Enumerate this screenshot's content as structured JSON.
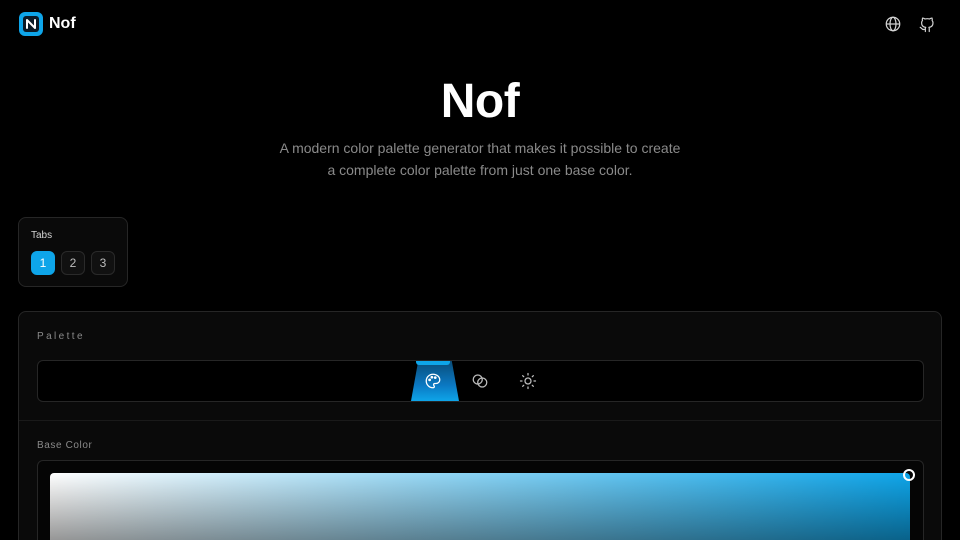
{
  "header": {
    "logo_letter": "N",
    "brand": "Nof",
    "icons": [
      "globe-icon",
      "github-icon"
    ]
  },
  "hero": {
    "title": "Nof",
    "subtitle_line1": "A modern color palette generator that makes it possible to create",
    "subtitle_line2": "a complete color palette from just one base color."
  },
  "tabs": {
    "label": "Tabs",
    "items": [
      "1",
      "2",
      "3"
    ],
    "active": "1"
  },
  "panel": {
    "palette_label": "Palette",
    "modes": [
      "palette-icon",
      "blend-circles-icon",
      "sun-icon"
    ],
    "active_mode": "palette-icon",
    "base_color_label": "Base Color"
  },
  "colors": {
    "accent": "#0ea5e9",
    "background": "#000000",
    "panel": "#0a0a0a",
    "border": "#262626",
    "muted_text": "#8a8a8a"
  }
}
